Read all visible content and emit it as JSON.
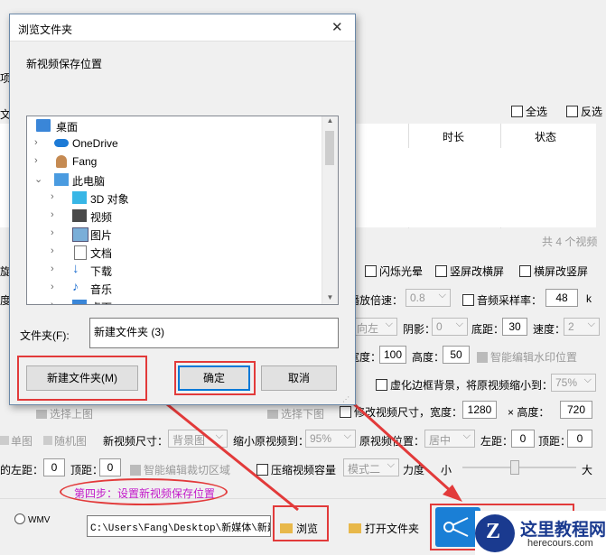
{
  "bg": {
    "top_select_all": "全选",
    "top_invert": "反选",
    "col_duration": "时长",
    "col_status": "状态",
    "total": "共 4 个视频",
    "row1": {
      "flash_light": "闪烁光晕",
      "portrait_to_landscape": "竖屏改横屏",
      "landscape_to_portrait": "横屏改竖屏"
    },
    "row2": {
      "speed_label": "播放倍速：",
      "speed_val": "0.8",
      "audio_rate": "音频采样率：",
      "audio_val": "48",
      "audio_unit": "k"
    },
    "row3": {
      "pos_val": "向左",
      "shadow_label": "阴影：",
      "shadow_val": "0",
      "bottom_label": "底距：",
      "bottom_val": "30",
      "speed_label": "速度：",
      "speed_val": "2"
    },
    "row4": {
      "width_label": "宽度：",
      "width_val": "100",
      "height_label": "高度：",
      "height_val": "50",
      "smart_wm": "智能编辑水印位置"
    },
    "row5": {
      "virtual_bg": "虚化边框背景，将原视频缩小到：",
      "shrink_val": "75%"
    },
    "row6": {
      "select_top": "选择上图",
      "select_bottom": "选择下图",
      "resize": "修改视频尺寸，宽度：",
      "w_val": "1280",
      "h_label": "×  高度：",
      "h_val": "720"
    },
    "row7": {
      "single": "单图",
      "random": "随机图",
      "size_label": "新视频尺寸：",
      "size_val": "背景图",
      "shrink_label": "缩小原视频到：",
      "shrink_val": "95%",
      "pos_label": "原视频位置：",
      "pos_val": "居中",
      "left_label": "左距：",
      "left_val": "0",
      "top_label": "顶距：",
      "top_val": "0"
    },
    "row8": {
      "left_label": "的左距：",
      "left_val": "0",
      "top_label": "顶距：",
      "top_val": "0",
      "smart_crop": "智能编辑裁切区域",
      "compress": "压缩视频容量",
      "mode_val": "模式二",
      "strength": "力度",
      "small": "小",
      "big": "大"
    },
    "step_note": "第四步：设置新视频保存位置",
    "wmv": "WMV",
    "path": "C:\\Users\\Fang\\Desktop\\新媒体\\新建",
    "browse": "浏览",
    "open_folder": "打开文件夹"
  },
  "dialog": {
    "title": "浏览文件夹",
    "close": "✕",
    "subtitle": "新视频保存位置",
    "tree": [
      {
        "label": "桌面",
        "icon": "desktop-icon"
      },
      {
        "label": "OneDrive",
        "icon": "cloud-icon"
      },
      {
        "label": "Fang",
        "icon": "user-icon"
      },
      {
        "label": "此电脑",
        "icon": "computer-icon"
      },
      {
        "label": "3D 对象",
        "icon": "cube-icon"
      },
      {
        "label": "视频",
        "icon": "film-icon"
      },
      {
        "label": "图片",
        "icon": "picture-icon"
      },
      {
        "label": "文档",
        "icon": "document-icon"
      },
      {
        "label": "下载",
        "icon": "download-icon"
      },
      {
        "label": "音乐",
        "icon": "music-icon"
      },
      {
        "label": "桌面",
        "icon": "desktop-icon"
      }
    ],
    "folder_label": "文件夹(F):",
    "folder_value": "新建文件夹 (3)",
    "new_folder": "新建文件夹(M)",
    "ok": "确定",
    "cancel": "取消"
  },
  "watermark": {
    "brand": "这里教程网",
    "url": "herecours.com"
  },
  "colors": {
    "accent_red": "#e23a3a",
    "note_purple": "#c219c9",
    "blue_btn": "#1a7fd6"
  }
}
